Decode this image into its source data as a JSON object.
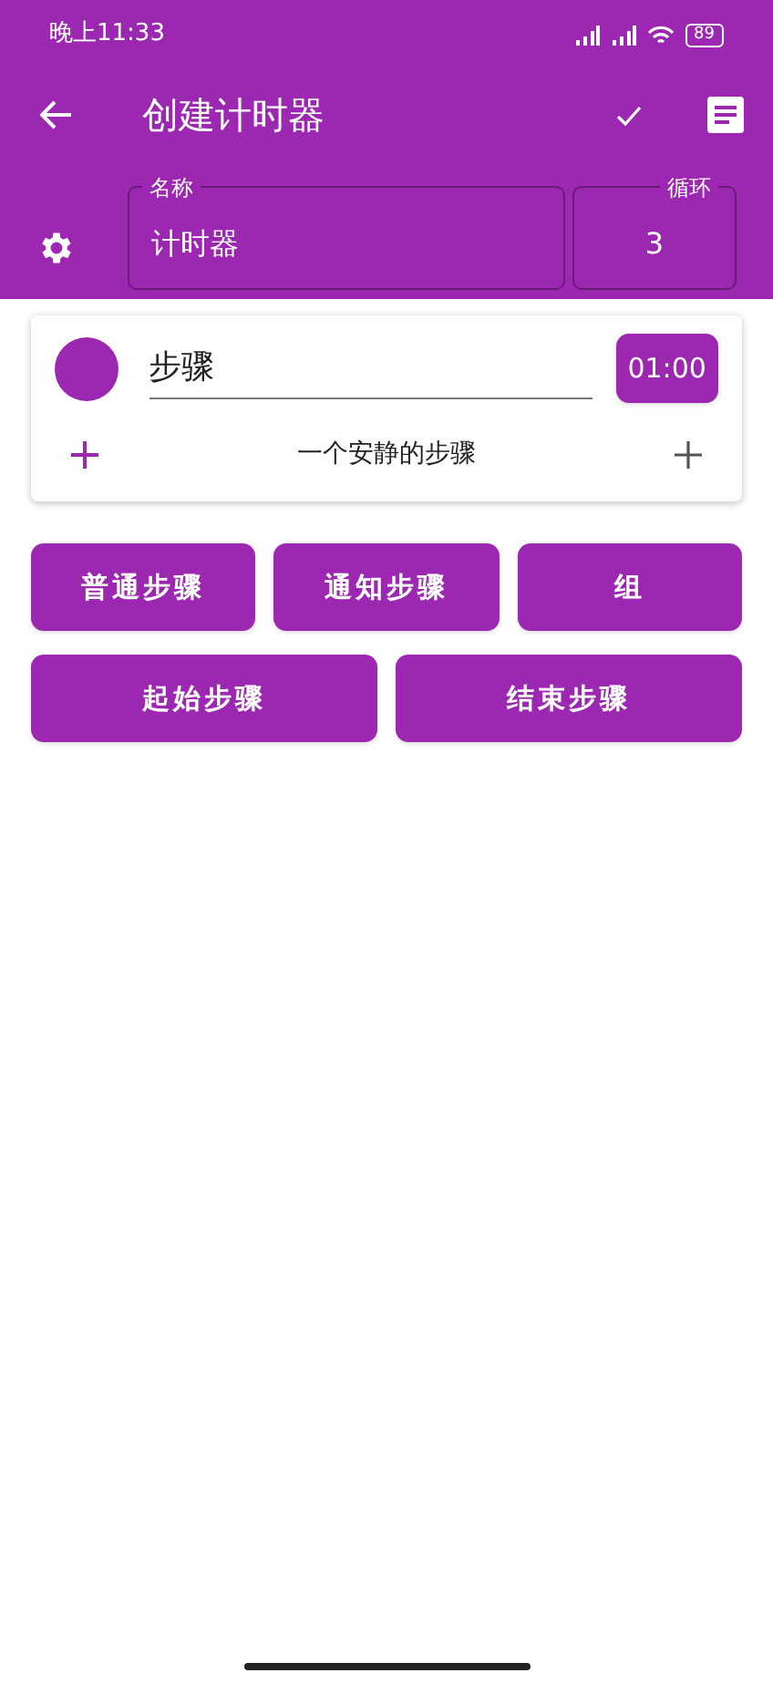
{
  "status_bar": {
    "time": "晚上11:33",
    "battery": "89"
  },
  "toolbar": {
    "title": "创建计时器"
  },
  "name_field": {
    "label": "名称",
    "value": "计时器"
  },
  "loop_field": {
    "label": "循环",
    "value": "3"
  },
  "step_card": {
    "name": "步骤",
    "duration": "01:00",
    "sound": "一个安静的步骤"
  },
  "button_rows": [
    [
      "普通步骤",
      "通知步骤",
      "组"
    ],
    [
      "起始步骤",
      "结束步骤"
    ]
  ]
}
